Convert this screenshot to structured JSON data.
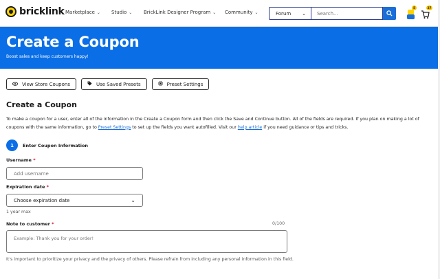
{
  "brand": {
    "name": "bricklink"
  },
  "nav": {
    "items": [
      {
        "label": "Marketplace"
      },
      {
        "label": "Studio"
      },
      {
        "label": "BrickLink Designer Program"
      },
      {
        "label": "Community"
      }
    ],
    "forum_select": "Forum",
    "search_placeholder": "Search...",
    "notification_count": "5",
    "cart_count": "27"
  },
  "hero": {
    "title": "Create a Coupon",
    "subtitle": "Boost sales and keep customers happy!"
  },
  "actions": {
    "view_store_coupons": "View Store Coupons",
    "use_saved_presets": "Use Saved Presets",
    "preset_settings": "Preset Settings"
  },
  "main": {
    "title": "Create a Coupon",
    "intro_part1": "To make a coupon for a user, enter all of the information in the Create a Coupon form and then click the Save and Continue button. All of the fields are required. If you plan on making a lot of coupons with the same information, go to ",
    "intro_link1": "Preset Settings",
    "intro_part2": " to set up the fields you want autofilled. Visit our ",
    "intro_link2": "help article",
    "intro_part3": " if you need guidance or tips and tricks.",
    "step_number": "1",
    "step_label": "Enter Coupon Information"
  },
  "form": {
    "username_label": "Username",
    "username_placeholder": "Add username",
    "expiration_label": "Expiration date",
    "expiration_value": "Choose expiration date",
    "expiration_hint": "1 year max",
    "note_label": "Note to customer",
    "note_counter": "0/100",
    "note_placeholder": "Example: Thank you for your order!",
    "privacy_note": "It's important to prioritize your privacy and the privacy of others. Please refrain from including any personal information in this field.",
    "required_mark": "*"
  },
  "colors": {
    "primary": "#0a6ee6",
    "brand_yellow": "#ffd400",
    "required": "#d0021b"
  }
}
